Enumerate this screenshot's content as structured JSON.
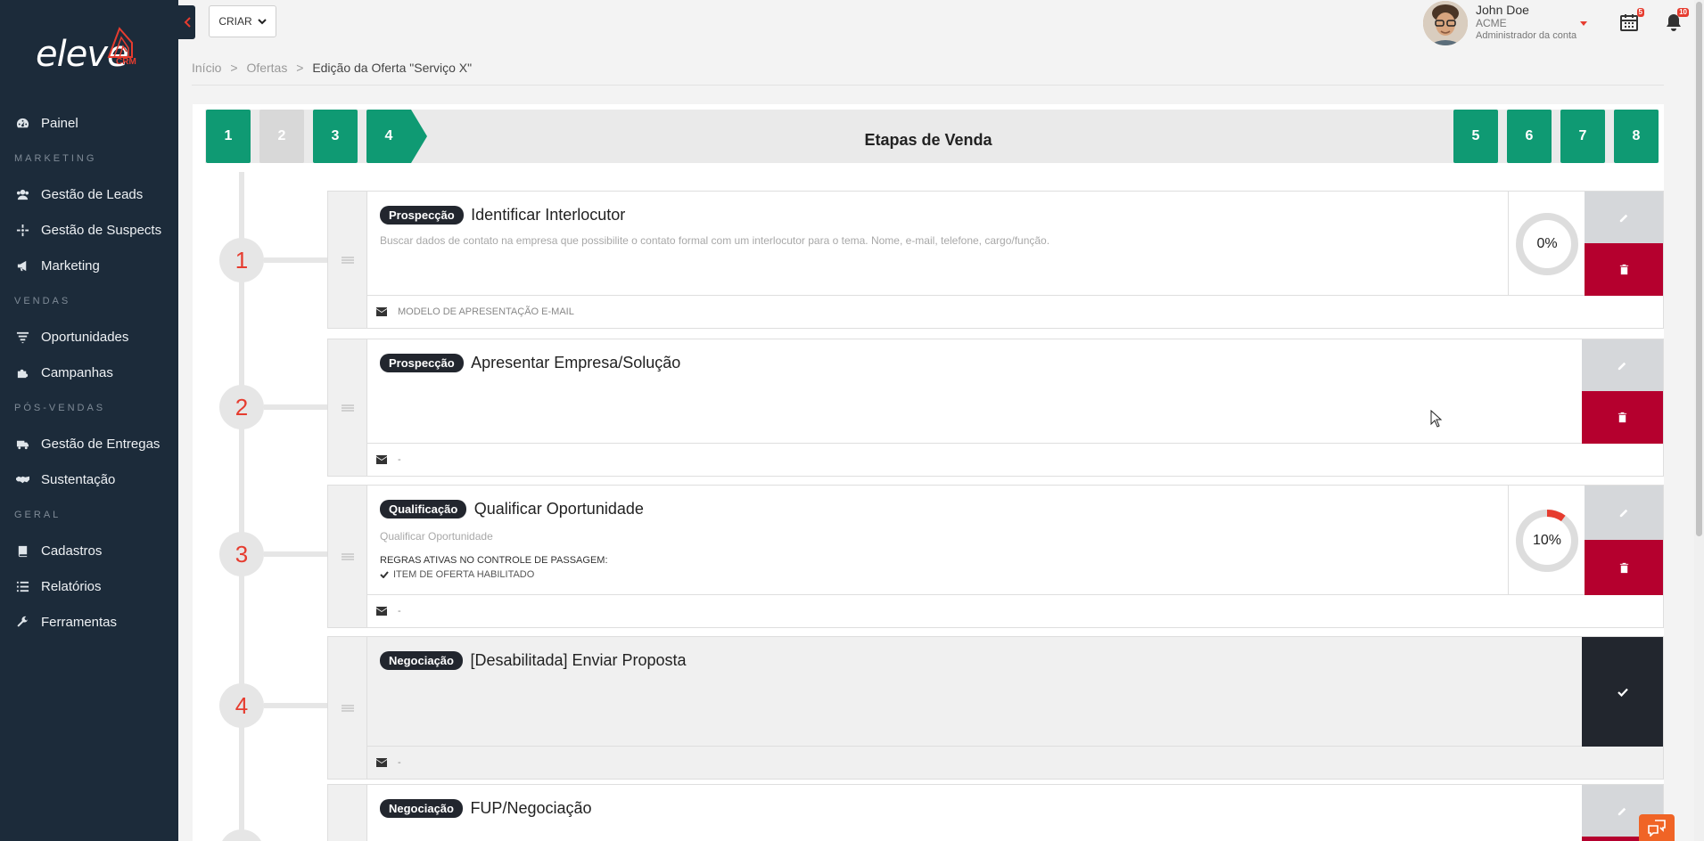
{
  "brand": {
    "wordmark": "eleve",
    "suffix": "CRM"
  },
  "sidebar": {
    "items": [
      {
        "type": "item",
        "label": "Painel",
        "icon": "dashboard-icon"
      },
      {
        "type": "section",
        "label": "MARKETING"
      },
      {
        "type": "item",
        "label": "Gestão de Leads",
        "icon": "users-icon"
      },
      {
        "type": "item",
        "label": "Gestão de Suspects",
        "icon": "crosshair-icon"
      },
      {
        "type": "item",
        "label": "Marketing",
        "icon": "megaphone-icon"
      },
      {
        "type": "section",
        "label": "VENDAS"
      },
      {
        "type": "item",
        "label": "Oportunidades",
        "icon": "funnel-icon"
      },
      {
        "type": "item",
        "label": "Campanhas",
        "icon": "puzzle-icon"
      },
      {
        "type": "section",
        "label": "PÓS-VENDAS"
      },
      {
        "type": "item",
        "label": "Gestão de Entregas",
        "icon": "truck-icon"
      },
      {
        "type": "item",
        "label": "Sustentação",
        "icon": "handshake-icon"
      },
      {
        "type": "section",
        "label": "GERAL"
      },
      {
        "type": "item",
        "label": "Cadastros",
        "icon": "book-icon"
      },
      {
        "type": "item",
        "label": "Relatórios",
        "icon": "list-icon"
      },
      {
        "type": "item",
        "label": "Ferramentas",
        "icon": "wrench-icon"
      }
    ]
  },
  "topbar": {
    "create_label": "CRIAR",
    "user": {
      "name": "John Doe",
      "company": "ACME",
      "role": "Administrador da conta"
    },
    "calendar_badge": "5",
    "notifications_badge": "10"
  },
  "breadcrumb": {
    "home": "Início",
    "sep": ">",
    "offers": "Ofertas",
    "current": "Edição da Oferta \"Serviço X\""
  },
  "steps": {
    "title": "Etapas de Venda",
    "left": [
      {
        "label": "1",
        "active": true
      },
      {
        "label": "2",
        "active": false
      },
      {
        "label": "3",
        "active": true
      },
      {
        "label": "4",
        "active": true
      }
    ],
    "right": [
      {
        "label": "5",
        "active": true
      },
      {
        "label": "6",
        "active": true
      },
      {
        "label": "7",
        "active": true
      },
      {
        "label": "8",
        "active": true
      }
    ]
  },
  "timeline": [
    "1",
    "2",
    "3",
    "4"
  ],
  "activities": [
    {
      "tag": "Prospecção",
      "title": "Identificar Interlocutor",
      "description": "Buscar dados de contato na empresa que possibilite o contato formal com um interlocutor para o tema. Nome, e-mail, telefone, cargo/função.",
      "footer": "MODELO DE APRESENTAÇÃO E-MAIL",
      "progress": 0,
      "progress_label": "0%"
    },
    {
      "tag": "Prospecção",
      "title": "Apresentar Empresa/Solução",
      "footer": "-"
    },
    {
      "tag": "Qualificação",
      "title": "Qualificar Oportunidade",
      "description": "Qualificar Oportunidade",
      "rules_title": "REGRAS ATIVAS NO CONTROLE DE PASSAGEM:",
      "rule_item": "ITEM DE OFERTA HABILITADO",
      "footer": "-",
      "progress": 10,
      "progress_label": "10%"
    },
    {
      "tag": "Negociação",
      "title": "[Desabilitada] Enviar Proposta",
      "footer": "-"
    },
    {
      "tag": "Negociação",
      "title": "FUP/Negociação"
    }
  ],
  "colors": {
    "primary": "#0f9a73",
    "danger": "#b5002e",
    "accent": "#e63c2f",
    "sidebar": "#1c2b3a",
    "dark": "#22262e"
  }
}
